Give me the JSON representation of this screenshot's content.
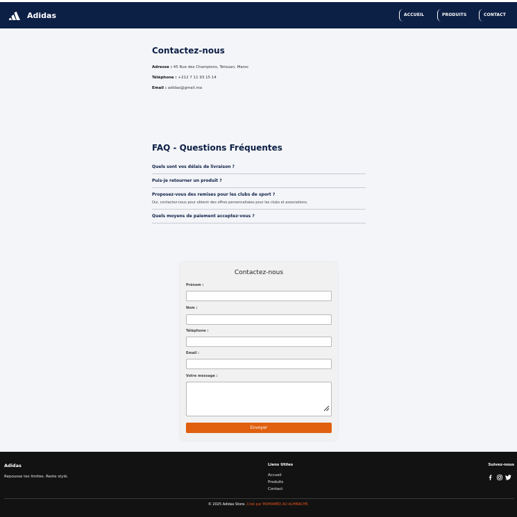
{
  "brand": {
    "name": "Adidas",
    "logo_icon": "adidas-logo-icon"
  },
  "nav": {
    "items": [
      {
        "label": "ACCUEIL"
      },
      {
        "label": "PRODUITS"
      },
      {
        "label": "CONTACT"
      }
    ]
  },
  "contact": {
    "title": "Contactez-nous",
    "lines": [
      {
        "label": "Adresse :",
        "value": "45 Rue des Champions, Tetouan, Maroc"
      },
      {
        "label": "Téléphone :",
        "value": "+212 7 11 93 15 14"
      },
      {
        "label": "Email :",
        "value": "adidas@gmail.ma"
      }
    ]
  },
  "faq": {
    "title": "FAQ - Questions Fréquentes",
    "items": [
      {
        "question": "Quels sont vos délais de livraison ?",
        "answer": ""
      },
      {
        "question": "Puis-je retourner un produit ?",
        "answer": ""
      },
      {
        "question": "Proposez-vous des remises pour les clubs de sport ?",
        "answer": "Oui, contactez-nous pour obtenir des offres personnalisées pour les clubs et associations."
      },
      {
        "question": "Quels moyens de paiement acceptez-vous ?",
        "answer": ""
      }
    ]
  },
  "form": {
    "title": "Contactez-nous",
    "fields": {
      "prenom": {
        "label": "Prénom :",
        "value": ""
      },
      "nom": {
        "label": "Nom :",
        "value": ""
      },
      "telephone": {
        "label": "Téléphone :",
        "value": ""
      },
      "email": {
        "label": "Email :",
        "value": ""
      },
      "message": {
        "label": "Votre message :",
        "value": ""
      }
    },
    "submit_label": "Envoyer"
  },
  "footer": {
    "brand": "Adidas",
    "tagline": "Repousse tes limites. Reste stylé.",
    "links_title": "Liens Utiles",
    "links": [
      {
        "label": "Accueil"
      },
      {
        "label": "Produits"
      },
      {
        "label": "Contact"
      }
    ],
    "follow_title": "Suivez-nous",
    "socials": [
      {
        "icon": "facebook-icon"
      },
      {
        "icon": "instagram-icon"
      },
      {
        "icon": "twitter-icon"
      }
    ],
    "copyright": "© 2025 Adidas Store.",
    "credit": "Créé par MOHAMED AU AUHBACHE."
  },
  "colors": {
    "navbar": "#0c1f45",
    "accent": "#e06010",
    "footer": "#121212",
    "page": "#f4f5f9"
  }
}
